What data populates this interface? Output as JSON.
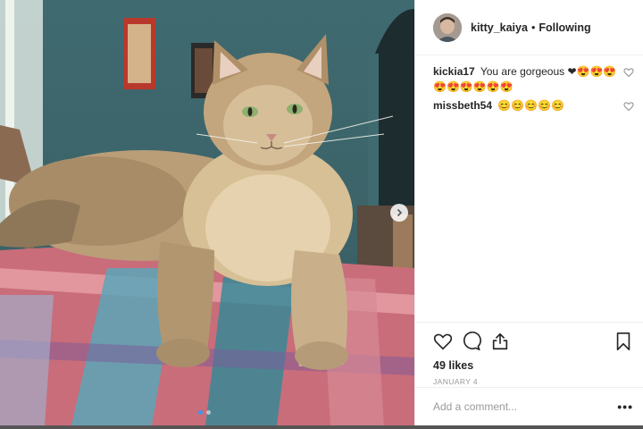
{
  "post": {
    "image_alt_subject": "",
    "carousel": {
      "slides": 2,
      "active": 0
    }
  },
  "header": {
    "username": "kitty_kaiya",
    "separator": "•",
    "follow_status": "Following"
  },
  "comments": [
    {
      "user": "kickia17",
      "text": "You are gorgeous ❤😍😍😍😍😍😍😍😍😍"
    },
    {
      "user": "missbeth54",
      "text": "😊😊😊😊😊"
    }
  ],
  "actions": {
    "likes": "49 likes",
    "date": "JANUARY 4"
  },
  "add_comment": {
    "placeholder": "Add a comment...",
    "more": "•••"
  },
  "icons": {
    "like": "heart-icon",
    "comment": "comment-icon",
    "share": "share-icon",
    "save": "bookmark-icon",
    "next": "chevron-right-icon"
  },
  "colors": {
    "accent": "#3897f0",
    "text": "#262626",
    "muted": "#999999",
    "border": "#efefef"
  }
}
